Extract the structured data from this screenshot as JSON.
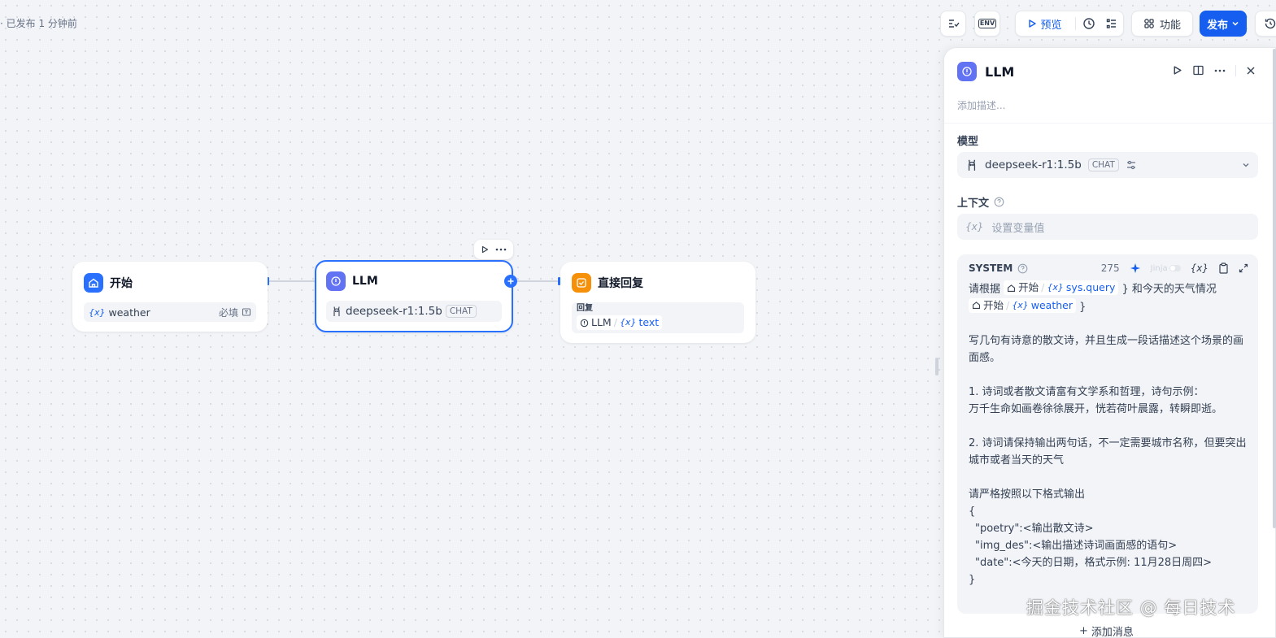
{
  "status": "· 已发布 1 分钟前",
  "toolbar": {
    "env_label": "ENV",
    "preview_label": "预览",
    "features_label": "功能",
    "publish_label": "发布"
  },
  "nodes": {
    "start": {
      "title": "开始",
      "var_name": "weather",
      "required_label": "必填"
    },
    "llm": {
      "title": "LLM",
      "model": "deepseek-r1:1.5b",
      "tag": "CHAT"
    },
    "answer": {
      "title": "直接回复",
      "field_label": "回复",
      "ref_node": "LLM",
      "ref_var": "text"
    }
  },
  "panel": {
    "title": "LLM",
    "description_placeholder": "添加描述...",
    "model_label": "模型",
    "model_name": "deepseek-r1:1.5b",
    "model_tag": "CHAT",
    "context_label": "上下文",
    "context_placeholder": "设置变量值",
    "system": {
      "label": "SYSTEM",
      "token_count": "275",
      "jinja_label": "Jinja",
      "line1_pre": "请根据",
      "ref1_node": "开始",
      "ref1_var": "sys.query",
      "line1_post": "} 和今天的天气情况",
      "ref2_node": "开始",
      "ref2_var": "weather",
      "ref2_post": "}",
      "p1": "写几句有诗意的散文诗，并且生成一段话描述这个场景的画面感。",
      "p2a": "1. 诗词或者散文请富有文学系和哲理，诗句示例：",
      "p2b": "万千生命如画卷徐徐展开，恍若荷叶晨露，转瞬即逝。",
      "p3": "2. 诗词请保持输出两句话，不一定需要城市名称，但要突出城市或者当天的天气",
      "p4": "请严格按照以下格式输出",
      "j1": "{",
      "j2": "\"poetry\":<输出散文诗>",
      "j3": "\"img_des\":<输出描述诗词画面感的语句>",
      "j4": "\"date\":<今天的日期，格式示例: 11月28日周四>",
      "j5": "}"
    },
    "add_message_label": "添加消息"
  },
  "watermark": "掘金技术社区 @ 每日技术",
  "colors": {
    "accent": "#155eef",
    "llm_icon": "#6172f3",
    "start_icon": "#2970ff",
    "answer_icon": "#f79009"
  }
}
